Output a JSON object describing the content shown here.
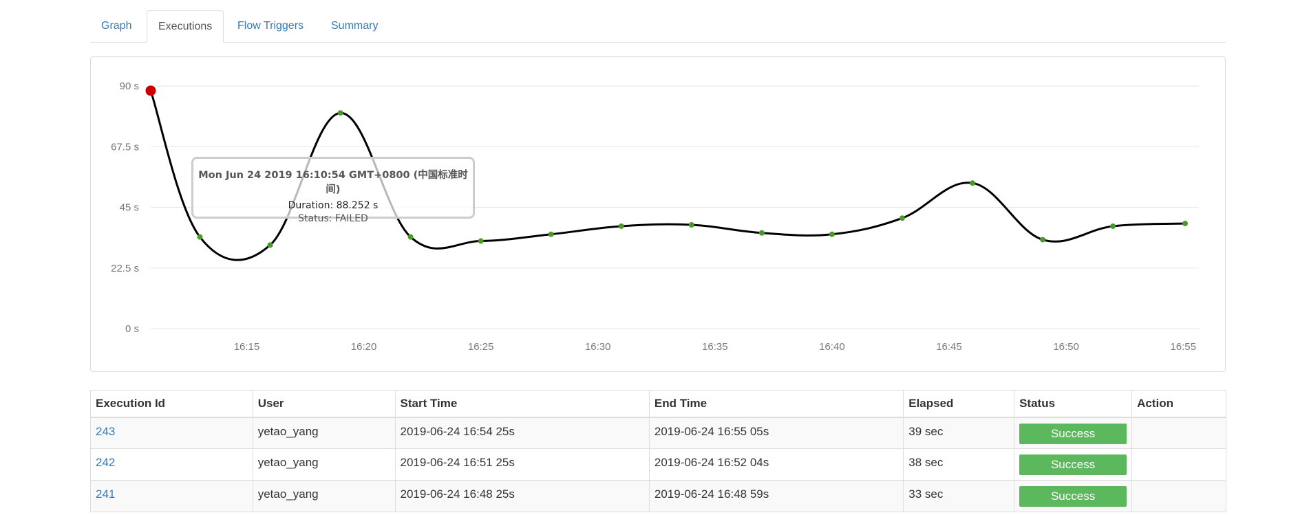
{
  "tabs": [
    {
      "label": "Graph"
    },
    {
      "label": "Executions"
    },
    {
      "label": "Flow Triggers"
    },
    {
      "label": "Summary"
    }
  ],
  "colors": {
    "link": "#337ab7",
    "success": "#5cb85c",
    "point_success": "#4a9a2a",
    "point_failed": "#cc0000",
    "line": "#000000"
  },
  "chart_data": {
    "type": "line",
    "ylim": [
      0,
      90
    ],
    "yticks": [
      "90 s",
      "67.5 s",
      "45 s",
      "22.5 s",
      "0 s"
    ],
    "ytick_values": [
      90,
      67.5,
      45,
      22.5,
      0
    ],
    "xticks": [
      "16:15",
      "16:20",
      "16:25",
      "16:30",
      "16:35",
      "16:40",
      "16:45",
      "16:50",
      "16:55"
    ],
    "xtick_values": [
      "16:15",
      "16:20",
      "16:25",
      "16:30",
      "16:35",
      "16:40",
      "16:45",
      "16:50",
      "16:55"
    ],
    "xlim": [
      "16:10:54",
      "16:55:05"
    ],
    "grid": true,
    "series": [
      {
        "points": [
          {
            "x": "16:10:54",
            "y": 88.252,
            "status": "FAILED"
          },
          {
            "x": "16:13",
            "y": 34,
            "status": "SUCCEEDED"
          },
          {
            "x": "16:16",
            "y": 31,
            "status": "SUCCEEDED"
          },
          {
            "x": "16:19",
            "y": 80,
            "status": "SUCCEEDED"
          },
          {
            "x": "16:22",
            "y": 34,
            "status": "SUCCEEDED"
          },
          {
            "x": "16:25",
            "y": 32.5,
            "status": "SUCCEEDED"
          },
          {
            "x": "16:28",
            "y": 35,
            "status": "SUCCEEDED"
          },
          {
            "x": "16:31",
            "y": 38,
            "status": "SUCCEEDED"
          },
          {
            "x": "16:34",
            "y": 38.5,
            "status": "SUCCEEDED"
          },
          {
            "x": "16:37",
            "y": 35.5,
            "status": "SUCCEEDED"
          },
          {
            "x": "16:40",
            "y": 35,
            "status": "SUCCEEDED"
          },
          {
            "x": "16:43",
            "y": 41,
            "status": "SUCCEEDED"
          },
          {
            "x": "16:46",
            "y": 54,
            "status": "SUCCEEDED"
          },
          {
            "x": "16:49",
            "y": 33,
            "status": "SUCCEEDED"
          },
          {
            "x": "16:52",
            "y": 38,
            "status": "SUCCEEDED"
          },
          {
            "x": "16:55:05",
            "y": 39,
            "status": "SUCCEEDED"
          }
        ]
      }
    ],
    "tooltip": {
      "title": "Mon Jun 24 2019 16:10:54 GMT+0800 (中国标准时间)",
      "duration": "Duration: 88.252 s",
      "status": "Status: FAILED"
    }
  },
  "table": {
    "headers": [
      "Execution Id",
      "User",
      "Start Time",
      "End Time",
      "Elapsed",
      "Status",
      "Action"
    ],
    "rows": [
      {
        "id": "243",
        "user": "yetao_yang",
        "start": "2019-06-24 16:54 25s",
        "end": "2019-06-24 16:55 05s",
        "elapsed": "39 sec",
        "status": "Success",
        "action": ""
      },
      {
        "id": "242",
        "user": "yetao_yang",
        "start": "2019-06-24 16:51 25s",
        "end": "2019-06-24 16:52 04s",
        "elapsed": "38 sec",
        "status": "Success",
        "action": ""
      },
      {
        "id": "241",
        "user": "yetao_yang",
        "start": "2019-06-24 16:48 25s",
        "end": "2019-06-24 16:48 59s",
        "elapsed": "33 sec",
        "status": "Success",
        "action": ""
      }
    ]
  }
}
